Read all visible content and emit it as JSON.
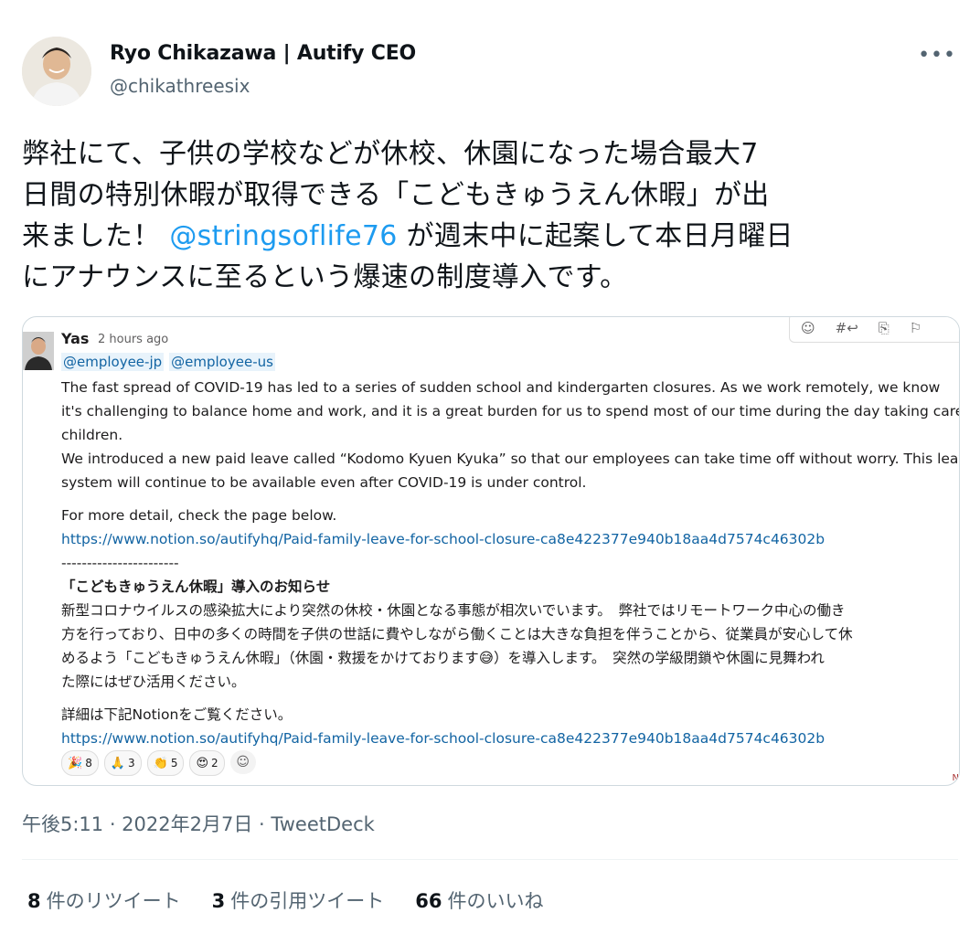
{
  "author": {
    "name": "Ryo Chikazawa | Autify CEO",
    "handle": "@chikathreesix",
    "more_label": "•••"
  },
  "tweet": {
    "text_parts": {
      "line1": "弊社にて、子供の学校などが休校、休園になった場合最大7",
      "line2": "日間の特別休暇が取得できる「こどもきゅうえん休暇」が出",
      "line3_before": "来ました！ ",
      "mention": "@stringsoflife76",
      "line3_after": " が週末中に起案して本日月曜日",
      "line4": "にアナウンスに至るという爆速の制度導入です。"
    }
  },
  "slack": {
    "user": "Yas",
    "time": "2 hours ago",
    "mentions": [
      "@employee-jp",
      "@employee-us"
    ],
    "lines": {
      "l1": "The fast spread of COVID-19 has led to a series of sudden school and kindergarten closures.    As we work remotely, we know",
      "l2": "it's challenging to balance home and work, and it is a great burden for us to spend most of our time during the day taking care of",
      "l3": "children.",
      "l4": "We introduced a new paid leave called “Kodomo Kyuen Kyuka” so that our employees can take time off without worry. This leav",
      "l5": "system will continue to be available even after COVID-19 is under control.",
      "l6": "For more detail, check the page below.",
      "link1": "https://www.notion.so/autifyhq/Paid-family-leave-for-school-closure-ca8e422377e940b18aa4d7574c46302b",
      "dashes": "-----------------------",
      "jp_title": "「こどもきゅうえん休暇」導入のお知らせ",
      "jp1": "新型コロナウイルスの感染拡大により突然の休校・休園となる事態が相次いでいます。　弊社ではリモートワーク中心の働き",
      "jp2": "方を行っており、日中の多くの時間を子供の世話に費やしながら働くことは大きな負担を伴うことから、従業員が安心して休",
      "jp3": "めるよう「こどもきゅうえん休暇」（休園・救援をかけております😅）を導入します。　突然の学級閉鎖や休園に見舞われ",
      "jp4": "た際にはぜひ活用ください。",
      "jp5": "詳細は下記Notionをご覧ください。",
      "link2": "https://www.notion.so/autifyhq/Paid-family-leave-for-school-closure-ca8e422377e940b18aa4d7574c46302b"
    },
    "reactions": [
      {
        "emoji": "🎉",
        "count": "8"
      },
      {
        "emoji": "🙏",
        "count": "3"
      },
      {
        "emoji": "👏",
        "count": "5"
      },
      {
        "emoji": "😍",
        "count": "2"
      }
    ],
    "corner_text": "N"
  },
  "meta": {
    "text": "午後5:11 · 2022年2月7日 · TweetDeck"
  },
  "stats": {
    "retweets_count": "8",
    "retweets_label": "件のリツイート",
    "quotes_count": "3",
    "quotes_label": "件の引用ツイート",
    "likes_count": "66",
    "likes_label": "件のいいね"
  },
  "colors": {
    "link": "#1d9bf0",
    "slack_link": "#1264a3",
    "secondary": "#536471"
  }
}
